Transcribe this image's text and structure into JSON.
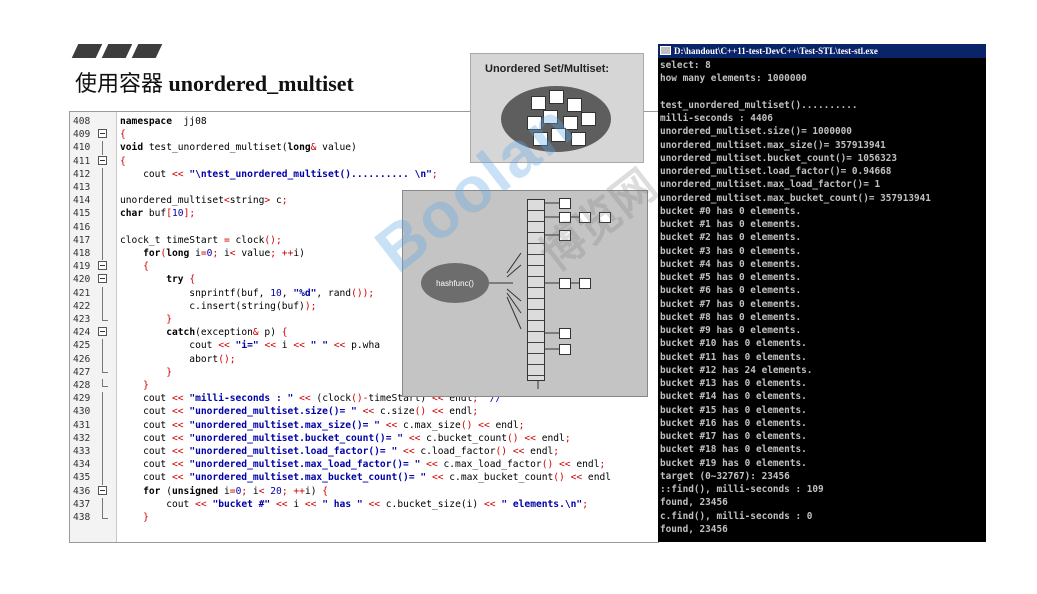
{
  "header": {
    "title_prefix": "使用容器 ",
    "title_bold": "unordered_multiset"
  },
  "set_panel": {
    "label": "Unordered Set/Multiset:"
  },
  "diagram": {
    "hash_label": "hashfunc()"
  },
  "watermark": {
    "text": "Boolan",
    "text2": "博览网"
  },
  "console": {
    "title": "D:\\handout\\C++11-test-DevC++\\Test-STL\\test-stl.exe",
    "lines": [
      "select: 8",
      "how many elements: 1000000",
      "",
      "test_unordered_multiset()..........",
      "milli-seconds : 4406",
      "unordered_multiset.size()= 1000000",
      "unordered_multiset.max_size()= 357913941",
      "unordered_multiset.bucket_count()= 1056323",
      "unordered_multiset.load_factor()= 0.94668",
      "unordered_multiset.max_load_factor()= 1",
      "unordered_multiset.max_bucket_count()= 357913941",
      "bucket #0 has 0 elements.",
      "bucket #1 has 0 elements.",
      "bucket #2 has 0 elements.",
      "bucket #3 has 0 elements.",
      "bucket #4 has 0 elements.",
      "bucket #5 has 0 elements.",
      "bucket #6 has 0 elements.",
      "bucket #7 has 0 elements.",
      "bucket #8 has 0 elements.",
      "bucket #9 has 0 elements.",
      "bucket #10 has 0 elements.",
      "bucket #11 has 0 elements.",
      "bucket #12 has 24 elements.",
      "bucket #13 has 0 elements.",
      "bucket #14 has 0 elements.",
      "bucket #15 has 0 elements.",
      "bucket #16 has 0 elements.",
      "bucket #17 has 0 elements.",
      "bucket #18 has 0 elements.",
      "bucket #19 has 0 elements.",
      "target (0~32767): 23456",
      "::find(), milli-seconds : 109",
      "found, 23456",
      "c.find(), milli-seconds : 0",
      "found, 23456"
    ]
  },
  "code": {
    "lines": [
      {
        "n": "408",
        "fold": "",
        "parts": [
          [
            "kw",
            "namespace"
          ],
          [
            "",
            "  jj08"
          ]
        ]
      },
      {
        "n": "409",
        "fold": "box",
        "parts": [
          [
            "op",
            "{"
          ]
        ]
      },
      {
        "n": "410",
        "fold": "line",
        "parts": [
          [
            "kw",
            "void"
          ],
          [
            "",
            " test_unordered_multiset("
          ],
          [
            "kw",
            "long"
          ],
          [
            "op",
            "&"
          ],
          [
            "",
            " value)"
          ]
        ]
      },
      {
        "n": "411",
        "fold": "box",
        "parts": [
          [
            "op",
            "{"
          ]
        ]
      },
      {
        "n": "412",
        "fold": "line",
        "parts": [
          [
            "",
            "    cout "
          ],
          [
            "op",
            "<<"
          ],
          [
            "",
            " "
          ],
          [
            "str",
            "\"\\ntest_unordered_multiset().......... \\n\""
          ],
          [
            "op",
            ";"
          ]
        ]
      },
      {
        "n": "413",
        "fold": "line",
        "parts": [
          [
            "",
            ""
          ]
        ]
      },
      {
        "n": "414",
        "fold": "line",
        "parts": [
          [
            "",
            "unordered_multiset"
          ],
          [
            "op",
            "<"
          ],
          [
            "",
            "string"
          ],
          [
            "op",
            ">"
          ],
          [
            "",
            " c"
          ],
          [
            "op",
            ";"
          ]
        ]
      },
      {
        "n": "415",
        "fold": "line",
        "parts": [
          [
            "kw",
            "char"
          ],
          [
            "",
            " buf"
          ],
          [
            "op",
            "["
          ],
          [
            "num",
            "10"
          ],
          [
            "op",
            "];"
          ]
        ]
      },
      {
        "n": "416",
        "fold": "line",
        "parts": [
          [
            "",
            ""
          ]
        ]
      },
      {
        "n": "417",
        "fold": "line",
        "parts": [
          [
            "",
            "clock_t timeStart "
          ],
          [
            "op",
            "="
          ],
          [
            "",
            " clock"
          ],
          [
            "op",
            "();"
          ]
        ]
      },
      {
        "n": "418",
        "fold": "line",
        "parts": [
          [
            "",
            "    "
          ],
          [
            "kw",
            "for"
          ],
          [
            "op",
            "("
          ],
          [
            "kw",
            "long"
          ],
          [
            "",
            " i"
          ],
          [
            "op",
            "="
          ],
          [
            "num",
            "0"
          ],
          [
            "op",
            ";"
          ],
          [
            "",
            " i"
          ],
          [
            "op",
            "<"
          ],
          [
            "",
            " value"
          ],
          [
            "op",
            ";"
          ],
          [
            "",
            " "
          ],
          [
            "op",
            "++"
          ],
          [
            "",
            "i)"
          ]
        ]
      },
      {
        "n": "419",
        "fold": "box",
        "parts": [
          [
            "",
            "    "
          ],
          [
            "op",
            "{"
          ]
        ]
      },
      {
        "n": "420",
        "fold": "box",
        "parts": [
          [
            "",
            "        "
          ],
          [
            "kw",
            "try"
          ],
          [
            "",
            " "
          ],
          [
            "op",
            "{"
          ]
        ]
      },
      {
        "n": "421",
        "fold": "line",
        "parts": [
          [
            "",
            "            snprintf(buf, "
          ],
          [
            "num",
            "10"
          ],
          [
            "",
            ", "
          ],
          [
            "str",
            "\"%d\""
          ],
          [
            "",
            ", rand"
          ],
          [
            "op",
            "())"
          ],
          [
            "op",
            ";"
          ]
        ]
      },
      {
        "n": "422",
        "fold": "line",
        "parts": [
          [
            "",
            "            c.insert(string(buf)"
          ],
          [
            "op",
            ");"
          ]
        ]
      },
      {
        "n": "423",
        "fold": "end",
        "parts": [
          [
            "",
            "        "
          ],
          [
            "op",
            "}"
          ]
        ]
      },
      {
        "n": "424",
        "fold": "box",
        "parts": [
          [
            "",
            "        "
          ],
          [
            "kw",
            "catch"
          ],
          [
            "",
            "(exception"
          ],
          [
            "op",
            "&"
          ],
          [
            "",
            " p) "
          ],
          [
            "op",
            "{"
          ]
        ]
      },
      {
        "n": "425",
        "fold": "line",
        "parts": [
          [
            "",
            "            cout "
          ],
          [
            "op",
            "<<"
          ],
          [
            "",
            " "
          ],
          [
            "str",
            "\"i=\""
          ],
          [
            "",
            " "
          ],
          [
            "op",
            "<<"
          ],
          [
            "",
            " i "
          ],
          [
            "op",
            "<<"
          ],
          [
            "",
            " "
          ],
          [
            "str",
            "\" \""
          ],
          [
            "",
            " "
          ],
          [
            "op",
            "<<"
          ],
          [
            "",
            " p.wha"
          ]
        ]
      },
      {
        "n": "426",
        "fold": "line",
        "parts": [
          [
            "",
            "            abort"
          ],
          [
            "op",
            "();"
          ]
        ]
      },
      {
        "n": "427",
        "fold": "end",
        "parts": [
          [
            "",
            "        "
          ],
          [
            "op",
            "}"
          ]
        ]
      },
      {
        "n": "428",
        "fold": "end",
        "parts": [
          [
            "",
            "    "
          ],
          [
            "op",
            "}"
          ]
        ]
      },
      {
        "n": "429",
        "fold": "line",
        "parts": [
          [
            "",
            "    cout "
          ],
          [
            "op",
            "<<"
          ],
          [
            "",
            " "
          ],
          [
            "str",
            "\"milli-seconds : \""
          ],
          [
            "",
            " "
          ],
          [
            "op",
            "<<"
          ],
          [
            "",
            " (clock"
          ],
          [
            "op",
            "()"
          ],
          [
            "op",
            "-"
          ],
          [
            "",
            "timeStart) "
          ],
          [
            "op",
            "<<"
          ],
          [
            "",
            " endl"
          ],
          [
            "op",
            ";"
          ],
          [
            "",
            "  "
          ],
          [
            "cm",
            "//"
          ]
        ]
      },
      {
        "n": "430",
        "fold": "line",
        "parts": [
          [
            "",
            "    cout "
          ],
          [
            "op",
            "<<"
          ],
          [
            "",
            " "
          ],
          [
            "str",
            "\"unordered_multiset.size()= \""
          ],
          [
            "",
            " "
          ],
          [
            "op",
            "<<"
          ],
          [
            "",
            " c.size"
          ],
          [
            "op",
            "()"
          ],
          [
            "",
            " "
          ],
          [
            "op",
            "<<"
          ],
          [
            "",
            " endl"
          ],
          [
            "op",
            ";"
          ]
        ]
      },
      {
        "n": "431",
        "fold": "line",
        "parts": [
          [
            "",
            "    cout "
          ],
          [
            "op",
            "<<"
          ],
          [
            "",
            " "
          ],
          [
            "str",
            "\"unordered_multiset.max_size()= \""
          ],
          [
            "",
            " "
          ],
          [
            "op",
            "<<"
          ],
          [
            "",
            " c.max_size"
          ],
          [
            "op",
            "()"
          ],
          [
            "",
            " "
          ],
          [
            "op",
            "<<"
          ],
          [
            "",
            " endl"
          ],
          [
            "op",
            ";"
          ]
        ]
      },
      {
        "n": "432",
        "fold": "line",
        "parts": [
          [
            "",
            "    cout "
          ],
          [
            "op",
            "<<"
          ],
          [
            "",
            " "
          ],
          [
            "str",
            "\"unordered_multiset.bucket_count()= \""
          ],
          [
            "",
            " "
          ],
          [
            "op",
            "<<"
          ],
          [
            "",
            " c.bucket_count"
          ],
          [
            "op",
            "()"
          ],
          [
            "",
            " "
          ],
          [
            "op",
            "<<"
          ],
          [
            "",
            " endl"
          ],
          [
            "op",
            ";"
          ]
        ]
      },
      {
        "n": "433",
        "fold": "line",
        "parts": [
          [
            "",
            "    cout "
          ],
          [
            "op",
            "<<"
          ],
          [
            "",
            " "
          ],
          [
            "str",
            "\"unordered_multiset.load_factor()= \""
          ],
          [
            "",
            " "
          ],
          [
            "op",
            "<<"
          ],
          [
            "",
            " c.load_factor"
          ],
          [
            "op",
            "()"
          ],
          [
            "",
            " "
          ],
          [
            "op",
            "<<"
          ],
          [
            "",
            " endl"
          ],
          [
            "op",
            ";"
          ]
        ]
      },
      {
        "n": "434",
        "fold": "line",
        "parts": [
          [
            "",
            "    cout "
          ],
          [
            "op",
            "<<"
          ],
          [
            "",
            " "
          ],
          [
            "str",
            "\"unordered_multiset.max_load_factor()= \""
          ],
          [
            "",
            " "
          ],
          [
            "op",
            "<<"
          ],
          [
            "",
            " c.max_load_factor"
          ],
          [
            "op",
            "()"
          ],
          [
            "",
            " "
          ],
          [
            "op",
            "<<"
          ],
          [
            "",
            " endl"
          ],
          [
            "op",
            ";"
          ]
        ]
      },
      {
        "n": "435",
        "fold": "line",
        "parts": [
          [
            "",
            "    cout "
          ],
          [
            "op",
            "<<"
          ],
          [
            "",
            " "
          ],
          [
            "str",
            "\"unordered_multiset.max_bucket_count()= \""
          ],
          [
            "",
            " "
          ],
          [
            "op",
            "<<"
          ],
          [
            "",
            " c.max_bucket_count"
          ],
          [
            "op",
            "()"
          ],
          [
            "",
            " "
          ],
          [
            "op",
            "<<"
          ],
          [
            "",
            " endl"
          ]
        ]
      },
      {
        "n": "436",
        "fold": "box",
        "parts": [
          [
            "",
            "    "
          ],
          [
            "kw",
            "for"
          ],
          [
            "",
            " ("
          ],
          [
            "kw",
            "unsigned"
          ],
          [
            "",
            " i"
          ],
          [
            "op",
            "="
          ],
          [
            "num",
            "0"
          ],
          [
            "op",
            ";"
          ],
          [
            "",
            " i"
          ],
          [
            "op",
            "<"
          ],
          [
            "",
            " "
          ],
          [
            "num",
            "20"
          ],
          [
            "op",
            ";"
          ],
          [
            "",
            " "
          ],
          [
            "op",
            "++"
          ],
          [
            "",
            "i) "
          ],
          [
            "op",
            "{"
          ]
        ]
      },
      {
        "n": "437",
        "fold": "line",
        "parts": [
          [
            "",
            "        cout "
          ],
          [
            "op",
            "<<"
          ],
          [
            "",
            " "
          ],
          [
            "str",
            "\"bucket #\""
          ],
          [
            "",
            " "
          ],
          [
            "op",
            "<<"
          ],
          [
            "",
            " i "
          ],
          [
            "op",
            "<<"
          ],
          [
            "",
            " "
          ],
          [
            "str",
            "\" has \""
          ],
          [
            "",
            " "
          ],
          [
            "op",
            "<<"
          ],
          [
            "",
            " c.bucket_size(i) "
          ],
          [
            "op",
            "<<"
          ],
          [
            "",
            " "
          ],
          [
            "str",
            "\" elements.\\n\""
          ],
          [
            "op",
            ";"
          ]
        ]
      },
      {
        "n": "438",
        "fold": "end",
        "parts": [
          [
            "",
            "    "
          ],
          [
            "op",
            "}"
          ]
        ]
      }
    ]
  }
}
